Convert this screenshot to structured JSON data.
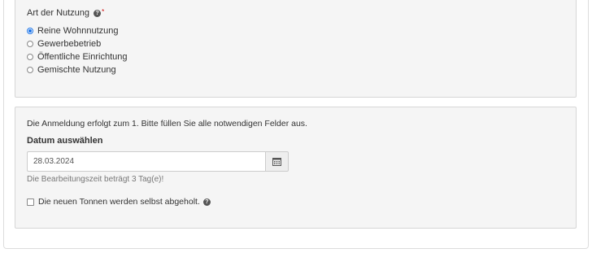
{
  "usage": {
    "label": "Art der Nutzung",
    "help_icon": "?",
    "required_marker": "*",
    "options": [
      {
        "label": "Reine Wohnnutzung",
        "selected": true
      },
      {
        "label": "Gewerbebetrieb",
        "selected": false
      },
      {
        "label": "Öffentliche Einrichtung",
        "selected": false
      },
      {
        "label": "Gemischte Nutzung",
        "selected": false
      }
    ]
  },
  "registration": {
    "info": "Die Anmeldung erfolgt zum 1. Bitte füllen Sie alle notwendigen Felder aus.",
    "date_label": "Datum auswählen",
    "date_value": "28.03.2024",
    "calendar_icon": "calendar-icon",
    "processing_hint": "Die Bearbeitungszeit beträgt 3 Tag(e)!",
    "bins_checkbox_label": "Die neuen Tonnen werden selbst abgeholt.",
    "bins_checkbox_checked": false,
    "help_icon": "?"
  },
  "colors": {
    "accent": "#1a73e8",
    "panel_bg": "#f5f5f5",
    "required": "#cc0000"
  }
}
